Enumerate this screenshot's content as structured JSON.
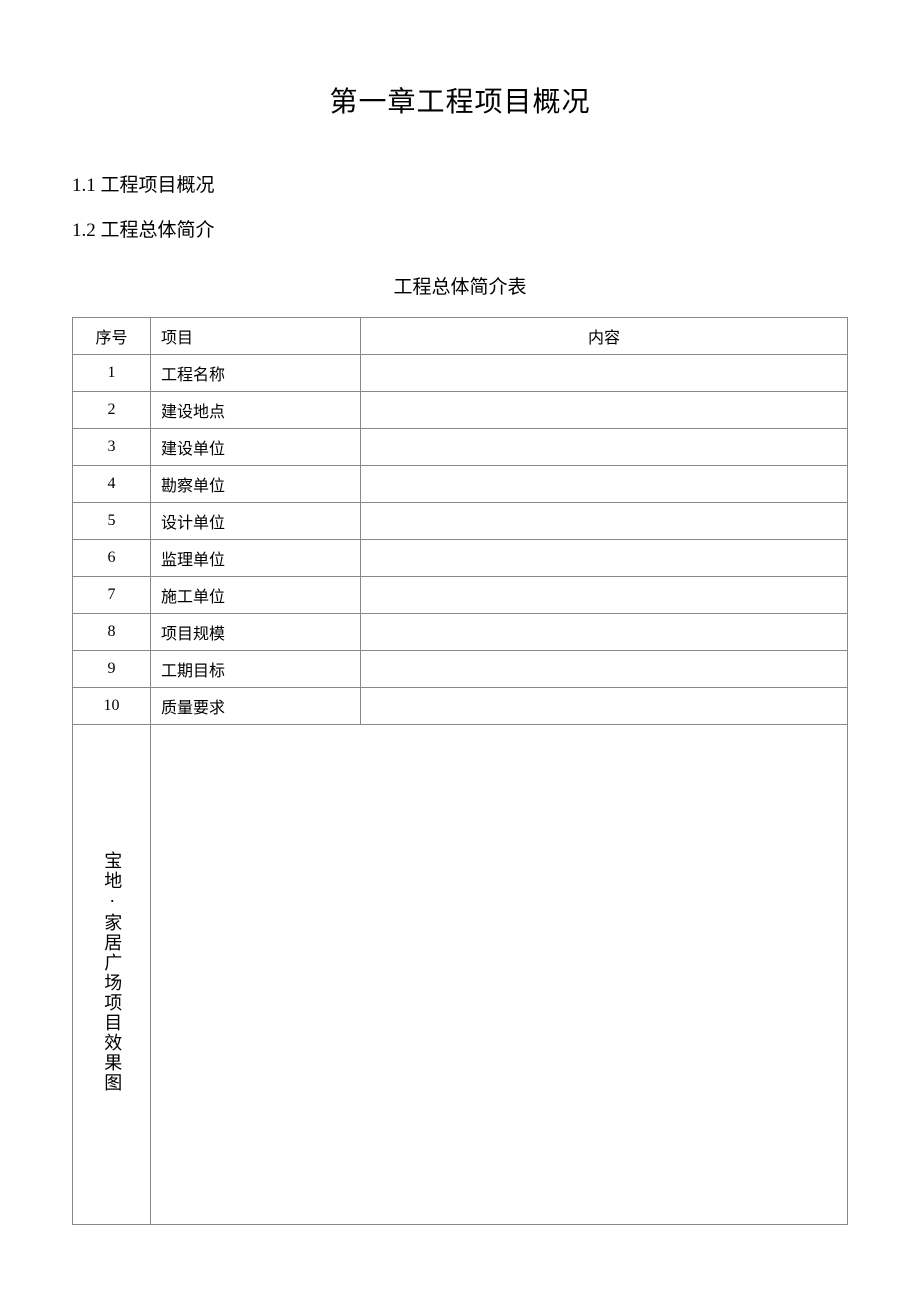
{
  "chapter_title": "第一章工程项目概况",
  "section_1_1": "1.1 工程项目概况",
  "section_1_2": "1.2 工程总体简介",
  "table_caption": "工程总体简介表",
  "table": {
    "headers": {
      "seq": "序号",
      "item": "项目",
      "content": "内容"
    },
    "rows": [
      {
        "seq": "1",
        "item": "工程名称",
        "content": ""
      },
      {
        "seq": "2",
        "item": "建设地点",
        "content": ""
      },
      {
        "seq": "3",
        "item": "建设单位",
        "content": ""
      },
      {
        "seq": "4",
        "item": "勘察单位",
        "content": ""
      },
      {
        "seq": "5",
        "item": "设计单位",
        "content": ""
      },
      {
        "seq": "6",
        "item": "监理单位",
        "content": ""
      },
      {
        "seq": "7",
        "item": "施工单位",
        "content": ""
      },
      {
        "seq": "8",
        "item": "项目规模",
        "content": ""
      },
      {
        "seq": "9",
        "item": "工期目标",
        "content": ""
      },
      {
        "seq": "10",
        "item": "质量要求",
        "content": ""
      }
    ],
    "vertical_row_label": "宝地·家居广场项目效果图"
  }
}
